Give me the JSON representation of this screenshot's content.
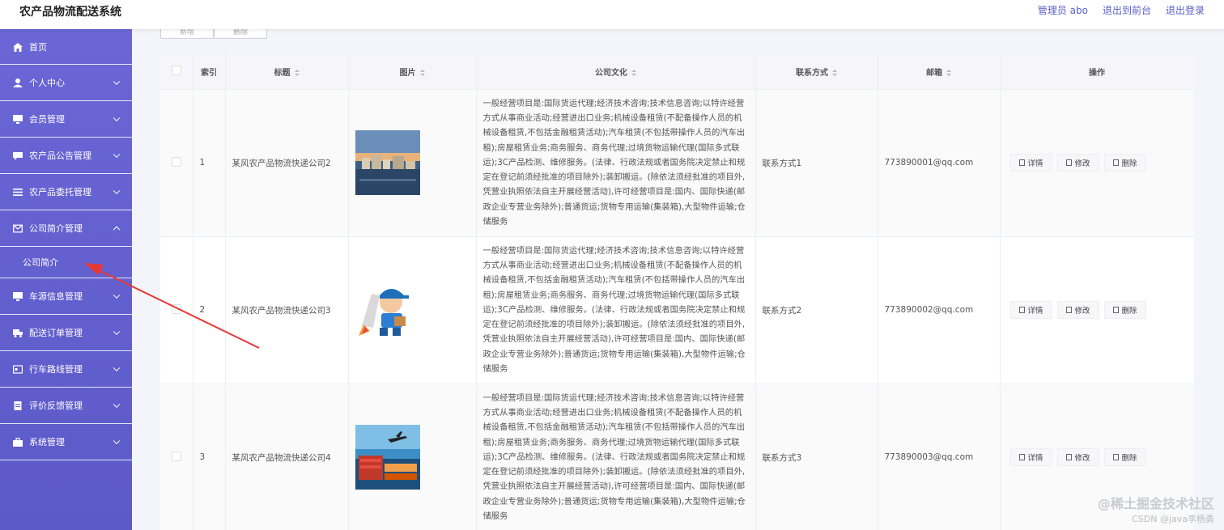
{
  "header": {
    "title": "农产品物流配送系统",
    "admin_label": "管理员 abo",
    "back_to_front": "退出到前台",
    "logout": "退出登录"
  },
  "sidebar": {
    "items": [
      {
        "label": "首页",
        "icon": "home-icon",
        "has_chevron": false
      },
      {
        "label": "个人中心",
        "icon": "user-icon",
        "has_chevron": true
      },
      {
        "label": "会员管理",
        "icon": "monitor-icon",
        "has_chevron": true
      },
      {
        "label": "农产品公告管理",
        "icon": "chat-icon",
        "has_chevron": true
      },
      {
        "label": "农产品委托管理",
        "icon": "list-icon",
        "has_chevron": true
      },
      {
        "label": "公司简介管理",
        "icon": "mail-icon",
        "has_chevron": true,
        "expanded": true
      },
      {
        "label": "车源信息管理",
        "icon": "monitor-icon",
        "has_chevron": true
      },
      {
        "label": "配送订单管理",
        "icon": "delivery-icon",
        "has_chevron": true
      },
      {
        "label": "行车路线管理",
        "icon": "card-icon",
        "has_chevron": true
      },
      {
        "label": "评价反馈管理",
        "icon": "doc-icon",
        "has_chevron": true
      },
      {
        "label": "系统管理",
        "icon": "briefcase-icon",
        "has_chevron": true
      }
    ],
    "submenu": {
      "label": "公司简介"
    }
  },
  "toolbar": {
    "add_label": "新增",
    "delete_label": "删除"
  },
  "table": {
    "columns": [
      "索引",
      "标题",
      "图片",
      "公司文化",
      "联系方式",
      "邮箱",
      "操作"
    ],
    "rows": [
      {
        "index": "1",
        "title": "某风农产品物流快递公司2",
        "image": "harbor-town-photo",
        "culture": "一般经营项目是:国际货运代理;经济技术咨询;技术信息咨询;以特许经营方式从事商业活动;经营进出口业务;机械设备租赁(不配备操作人员的机械设备租赁,不包括金融租赁活动);汽车租赁(不包括带操作人员的汽车出租);房屋租赁业务;商务服务、商务代理;过境货物运输代理(国际多式联运);3C产品检测、维修服务。(法律、行政法规或者国务院决定禁止和规定在登记前须经批准的项目除外);装卸搬运。(除依法须经批准的项目外,凭营业执照依法自主开展经营活动),许可经营项目是:国内、国际快递(邮政企业专营业务除外);普通货运;货物专用运输(集装箱),大型物件运输;仓储服务",
        "contact": "联系方式1",
        "email": "773890001@qq.com"
      },
      {
        "index": "2",
        "title": "某风农产品物流快递公司3",
        "image": "courier-rocket-cartoon",
        "culture": "一般经营项目是:国际货运代理;经济技术咨询;技术信息咨询;以特许经营方式从事商业活动;经营进出口业务;机械设备租赁(不配备操作人员的机械设备租赁,不包括金融租赁活动);汽车租赁(不包括带操作人员的汽车出租);房屋租赁业务;商务服务、商务代理;过境货物运输代理(国际多式联运);3C产品检测、维修服务。(法律、行政法规或者国务院决定禁止和规定在登记前须经批准的项目除外);装卸搬运。(除依法须经批准的项目外,凭营业执照依法自主开展经营活动),许可经营项目是:国内、国际快递(邮政企业专营业务除外);普通货运;货物专用运输(集装箱),大型物件运输;仓储服务",
        "contact": "联系方式2",
        "email": "773890002@qq.com"
      },
      {
        "index": "3",
        "title": "某风农产品物流快递公司4",
        "image": "logistics-plane-truck-photo",
        "culture": "一般经营项目是:国际货运代理;经济技术咨询;技术信息咨询;以特许经营方式从事商业活动;经营进出口业务;机械设备租赁(不配备操作人员的机械设备租赁,不包括金融租赁活动);汽车租赁(不包括带操作人员的汽车出租);房屋租赁业务;商务服务、商务代理;过境货物运输代理(国际多式联运);3C产品检测、维修服务。(法律、行政法规或者国务院决定禁止和规定在登记前须经批准的项目除外);装卸搬运。(除依法须经批准的项目外,凭营业执照依法自主开展经营活动),许可经营项目是:国内、国际快递(邮政企业专营业务除外);普通货运;货物专用运输(集装箱),大型物件运输;仓储服务",
        "contact": "联系方式3",
        "email": "773890003@qq.com"
      }
    ],
    "actions": {
      "detail": "详情",
      "edit": "修改",
      "delete": "删除"
    }
  },
  "watermark": {
    "line1": "@稀土掘金技术社区",
    "line2": "CSDN @java李杨勇"
  },
  "colors": {
    "sidebar": "#5f5bcc",
    "accent": "#5b5fc7",
    "annotation_arrow": "#e53935"
  }
}
